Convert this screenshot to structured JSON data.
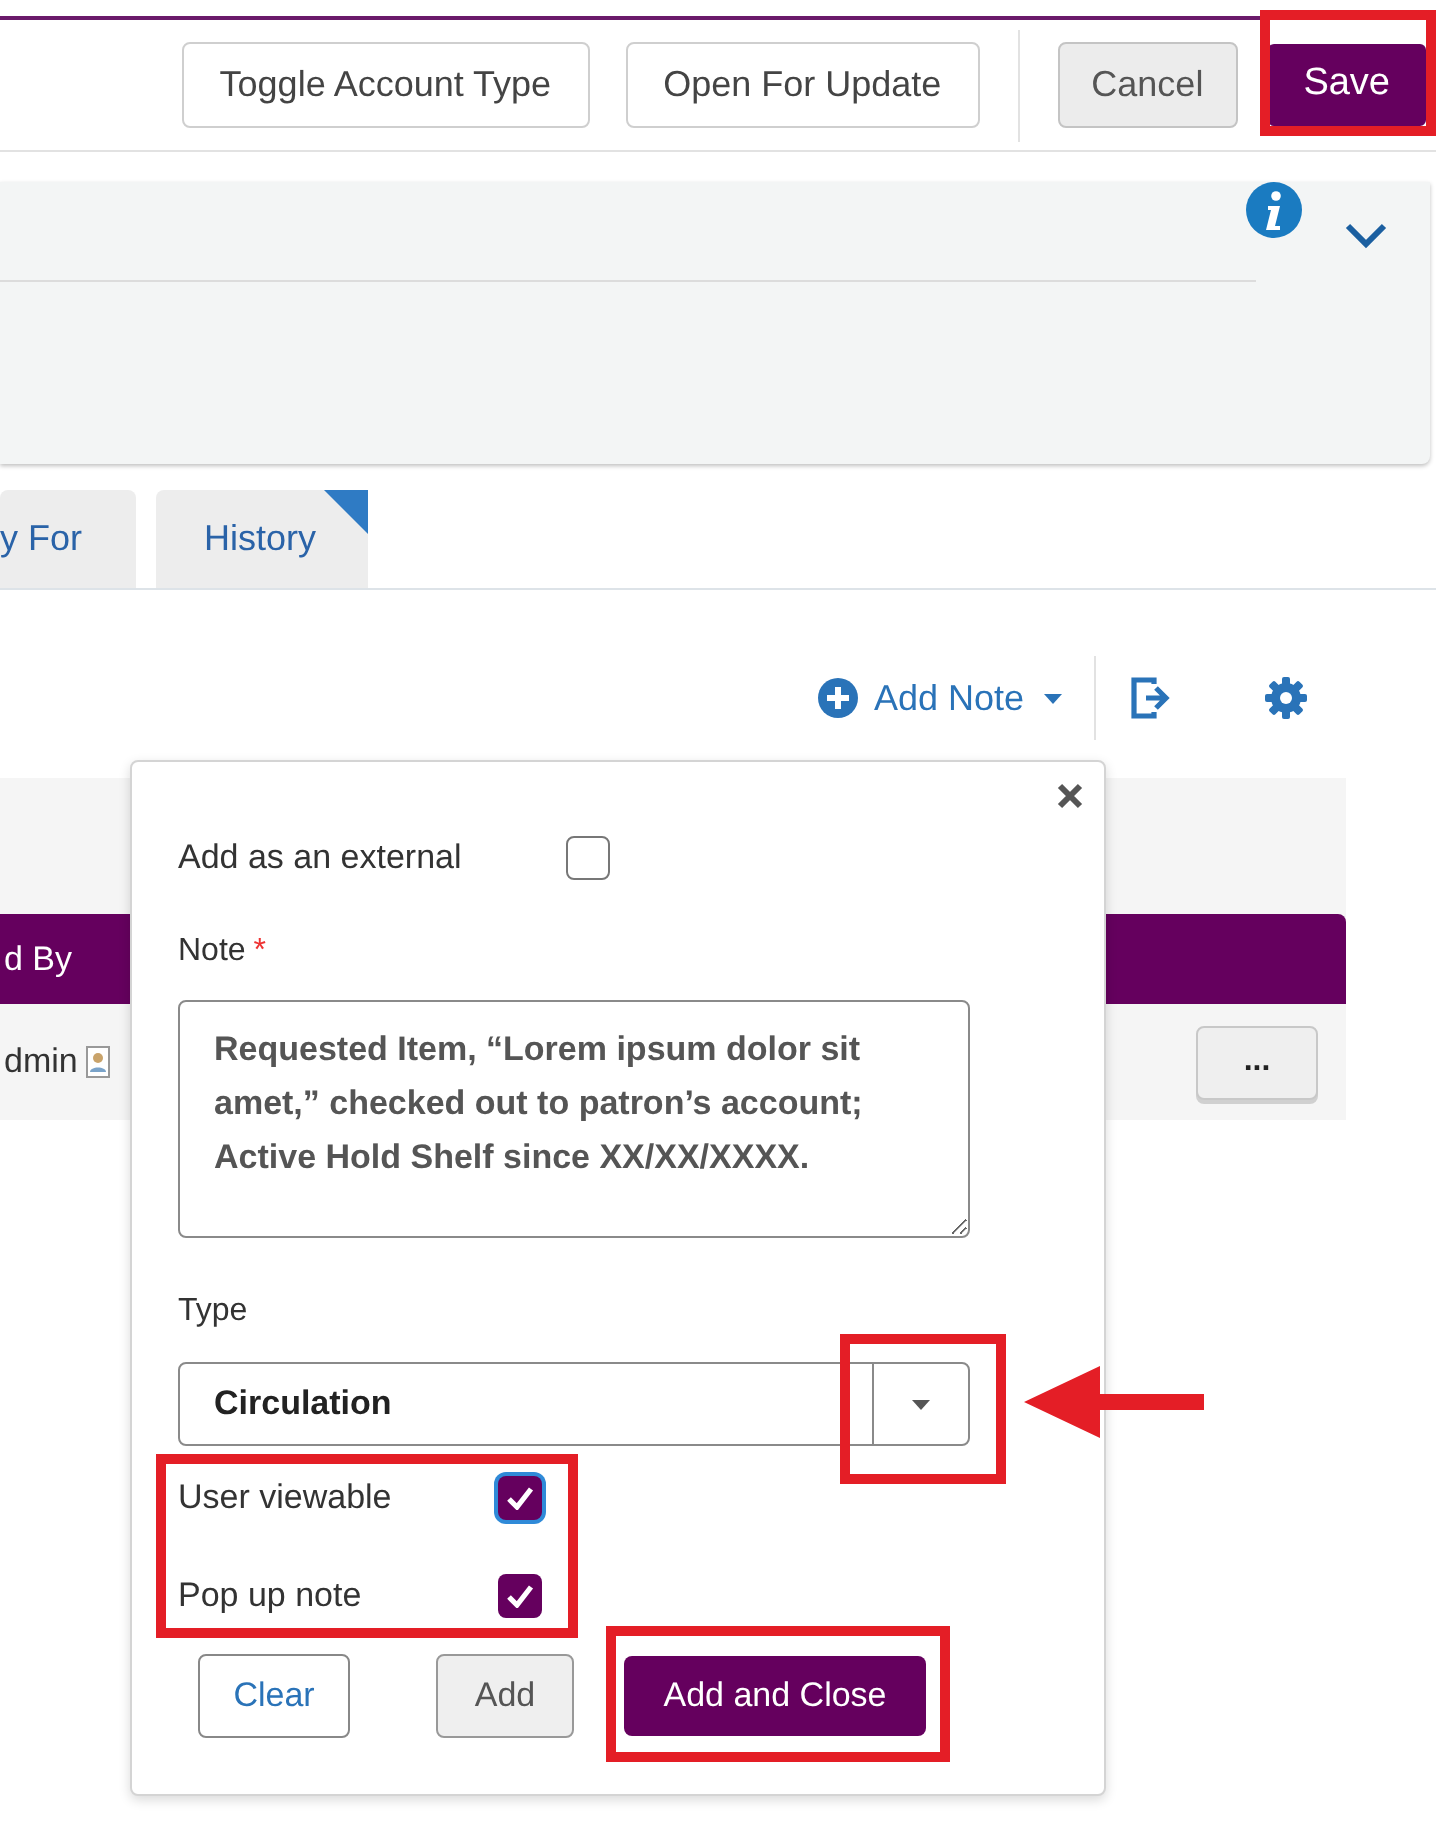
{
  "toolbar": {
    "buttons": [
      {
        "label": "Toggle Account Type",
        "kind": "default"
      },
      {
        "label": "Open For Update",
        "kind": "default"
      },
      {
        "label": "Cancel",
        "kind": "secondary"
      },
      {
        "label": "Save",
        "kind": "primary"
      }
    ]
  },
  "tabs": [
    {
      "label": "y For",
      "selected": false
    },
    {
      "label": "History",
      "selected": false
    }
  ],
  "notes_toolbar": {
    "add_button": "Add Note"
  },
  "table": {
    "columns": [
      "d By"
    ],
    "rows": [
      {
        "cells": [
          "dmin"
        ],
        "actions": "..."
      }
    ]
  },
  "note_popup": {
    "external": {
      "label": "Add as an external",
      "checked": false
    },
    "note_label": "Note",
    "required_mark": "*",
    "note_value": "Requested Item, “Lorem ipsum dolor sit amet,” checked out to patron’s account; Active Hold Shelf since XX/XX/XXXX.",
    "type_label": "Type",
    "type_value": "Circulation",
    "options": [
      {
        "label": "User viewable",
        "checked": true
      },
      {
        "label": "Pop up note",
        "checked": true
      }
    ],
    "buttons": [
      {
        "label": "Clear",
        "kind": "link"
      },
      {
        "label": "Add",
        "kind": "secondary"
      },
      {
        "label": "Add and Close",
        "kind": "primary"
      }
    ]
  }
}
